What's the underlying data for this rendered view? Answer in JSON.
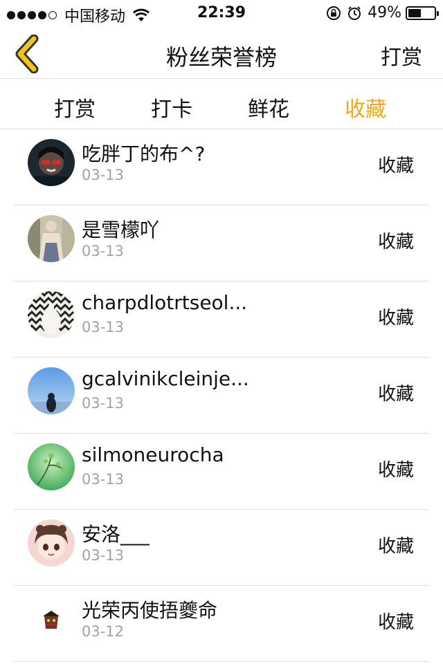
{
  "status_bar": {
    "carrier": "中国移动",
    "time": "22:39",
    "battery_percent": "49%",
    "battery_level": 0.49,
    "signal_dots_filled": 4,
    "signal_dots_total": 5
  },
  "nav": {
    "title": "粉丝荣誉榜",
    "right_label": "打赏",
    "back_icon": "chevron-left-icon"
  },
  "tabs": [
    {
      "label": "打赏",
      "active": false
    },
    {
      "label": "打卡",
      "active": false
    },
    {
      "label": "鲜花",
      "active": false
    },
    {
      "label": "收藏",
      "active": true
    }
  ],
  "colors": {
    "accent": "#f0a81c",
    "date_gray": "#a2a2a2",
    "divider": "#dcdcdc"
  },
  "list": [
    {
      "name": "吃胖丁的布^?",
      "date": "03-13",
      "action": "收藏"
    },
    {
      "name": "是雪檬吖",
      "date": "03-13",
      "action": "收藏"
    },
    {
      "name": "charpdlotrtseol...",
      "date": "03-13",
      "action": "收藏"
    },
    {
      "name": "gcalvinikcleinje...",
      "date": "03-13",
      "action": "收藏"
    },
    {
      "name": "silmoneurocha",
      "date": "03-13",
      "action": "收藏"
    },
    {
      "name": "安洛___",
      "date": "03-13",
      "action": "收藏"
    },
    {
      "name": "光荣丙使捂夔命",
      "date": "03-12",
      "action": "收藏"
    }
  ]
}
